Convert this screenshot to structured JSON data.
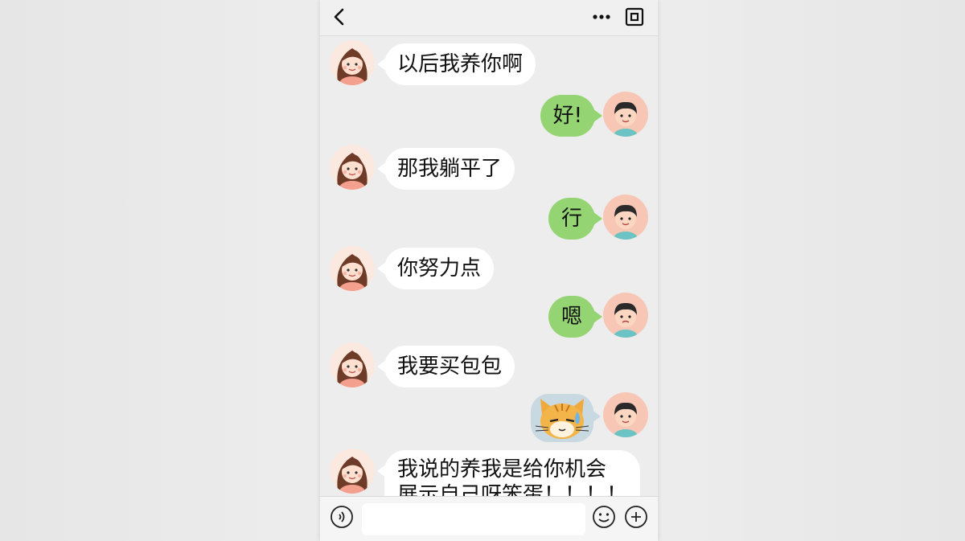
{
  "header": {
    "back_icon": "chevron-left-icon",
    "more_icon": "ellipsis-icon",
    "scan_icon": "square-frame-icon"
  },
  "messages": [
    {
      "side": "left",
      "sender": "girl",
      "text": "以后我养你啊"
    },
    {
      "side": "right",
      "sender": "boy",
      "text": "好!"
    },
    {
      "side": "left",
      "sender": "girl",
      "text": "那我躺平了"
    },
    {
      "side": "right",
      "sender": "boy",
      "text": "行"
    },
    {
      "side": "left",
      "sender": "girl",
      "text": "你努力点"
    },
    {
      "side": "right",
      "sender": "boy",
      "text": "嗯"
    },
    {
      "side": "left",
      "sender": "girl",
      "text": "我要买包包"
    },
    {
      "side": "right",
      "sender": "boy",
      "sticker": "sweating-cat-sticker"
    },
    {
      "side": "left",
      "sender": "girl",
      "lines": [
        "我说的养我是给你机会",
        "展示自己呀笨蛋！！！！"
      ]
    }
  ],
  "input": {
    "voice_icon": "voice-icon",
    "emoji_icon": "smiley-icon",
    "plus_icon": "plus-circle-icon",
    "value": "",
    "placeholder": ""
  },
  "colors": {
    "chat_bg": "#ededed",
    "sent_bubble": "#95d473",
    "received_bubble": "#ffffff"
  }
}
